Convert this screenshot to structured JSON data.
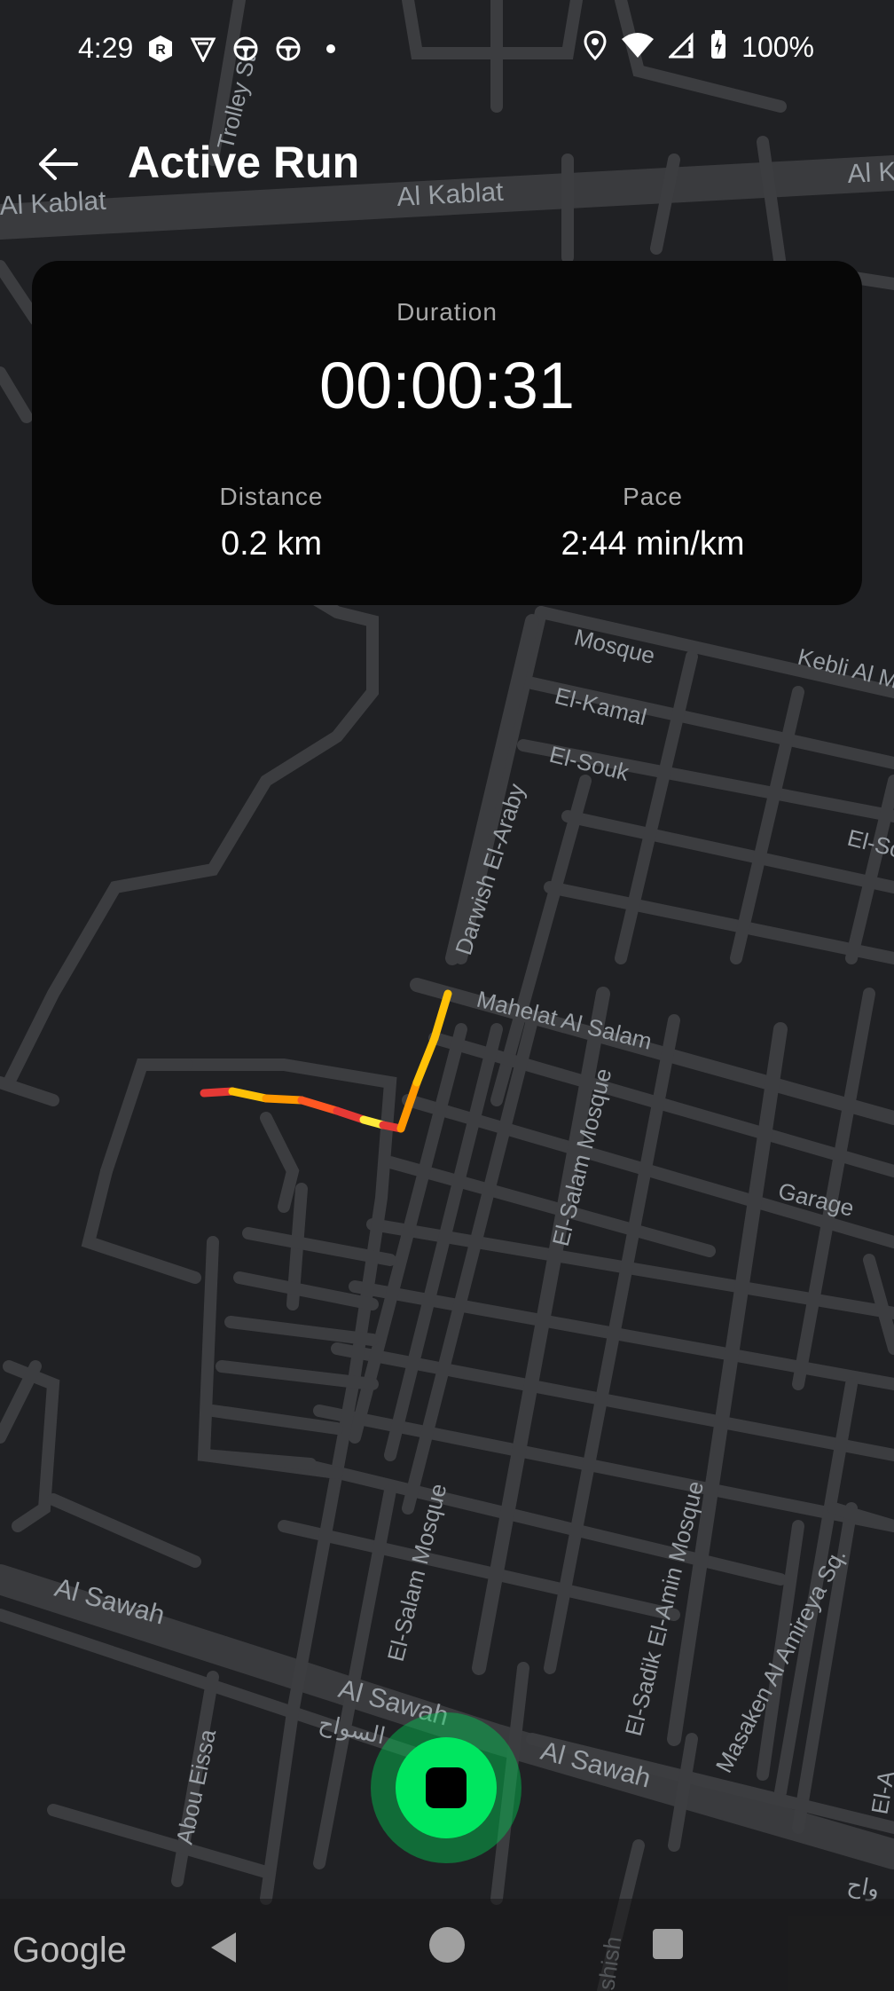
{
  "status_bar": {
    "time": "4:29",
    "left_icons": [
      "r-badge-icon",
      "shield-v-icon",
      "steering-wheel-icon",
      "steering-wheel-icon",
      "dot-icon"
    ],
    "right_icons": [
      "location-icon",
      "wifi-icon",
      "signal-icon",
      "battery-charging-icon"
    ],
    "battery": "100%"
  },
  "header": {
    "title": "Active Run",
    "back_icon": "arrow-left-icon"
  },
  "stats": {
    "duration_label": "Duration",
    "duration_value": "00:00:31",
    "distance_label": "Distance",
    "distance_value": "0.2 km",
    "pace_label": "Pace",
    "pace_value": "2:44 min/km"
  },
  "map": {
    "attribution": "Google",
    "route_colors": [
      "#ffc107",
      "#ff9800",
      "#ff5722",
      "#e53935",
      "#ffeb3b"
    ],
    "street_labels": [
      "Al Kablat",
      "Al Kablat",
      "Al K",
      "Trolley St",
      "Mosque",
      "Kebli Al M",
      "El-Kamal",
      "El-Souk",
      "El-Sc",
      "Darwish El-Araby",
      "Mahelat Al Salam",
      "El-Salam Mosque",
      "Garage",
      "Al Sawah",
      "Al Sawah",
      "Al Sawah",
      "السواح",
      "El-Salam Mosque",
      "El-Sadik El-Amin Mosque",
      "Masaken Al Amireya Sq.",
      "Abou Eissa",
      "El-A",
      "shish",
      "واح"
    ]
  },
  "controls": {
    "stop_button": "stop-icon"
  },
  "nav_bar": {
    "back": "nav-back-icon",
    "home": "nav-home-icon",
    "recents": "nav-recents-icon"
  }
}
